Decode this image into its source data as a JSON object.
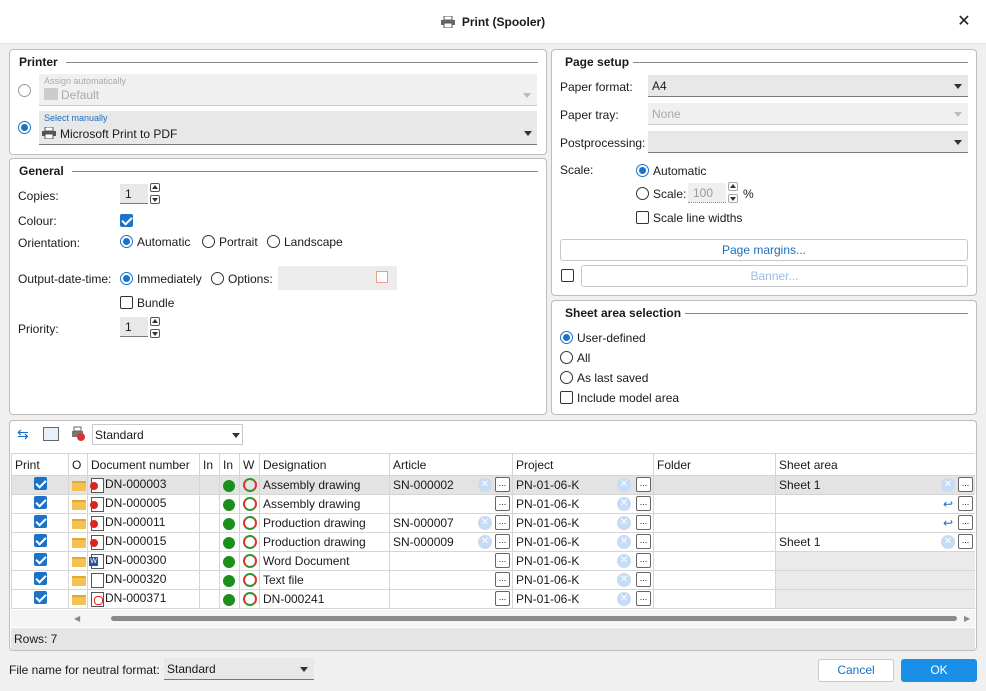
{
  "dialog": {
    "title": "Print (Spooler)"
  },
  "printer": {
    "section_title": "Printer",
    "auto_label": "Assign automatically",
    "auto_value": "Default",
    "manual_label": "Select manually",
    "manual_value": "Microsoft Print to PDF"
  },
  "general": {
    "section_title": "General",
    "copies_label": "Copies:",
    "copies_value": "1",
    "colour_label": "Colour:",
    "orientation_label": "Orientation:",
    "orient_automatic": "Automatic",
    "orient_portrait": "Portrait",
    "orient_landscape": "Landscape",
    "output_label": "Output-date-time:",
    "output_immediately": "Immediately",
    "output_options": "Options:",
    "bundle_label": "Bundle",
    "priority_label": "Priority:",
    "priority_value": "1"
  },
  "page_setup": {
    "section_title": "Page setup",
    "paper_format_label": "Paper format:",
    "paper_format_value": "A4",
    "paper_tray_label": "Paper tray:",
    "paper_tray_value": "None",
    "postprocessing_label": "Postprocessing:",
    "postprocessing_value": "",
    "scale_label": "Scale:",
    "scale_automatic": "Automatic",
    "scale_custom": "Scale:",
    "scale_value": "100",
    "scale_unit": "%",
    "scale_line_widths": "Scale line widths",
    "page_margins_button": "Page margins...",
    "banner_button": "Banner..."
  },
  "sheet_area": {
    "section_title": "Sheet area selection",
    "user_defined": "User-defined",
    "all": "All",
    "as_last_saved": "As last saved",
    "include_model_area": "Include model area"
  },
  "toolbar": {
    "profile_value": "Standard"
  },
  "table": {
    "headers": [
      "Print",
      "O",
      "Document number",
      "In",
      "In",
      "W",
      "Designation",
      "Article",
      "Project",
      "Folder",
      "Sheet area"
    ],
    "rows": [
      {
        "doc": "DN-000003",
        "designation": "Assembly drawing",
        "article": "SN-000002",
        "project": "PN-01-06-K",
        "sheet": "Sheet 1",
        "icon": "red"
      },
      {
        "doc": "DN-000005",
        "designation": "Assembly drawing",
        "article": "",
        "project": "PN-01-06-K",
        "sheet": "",
        "icon": "red"
      },
      {
        "doc": "DN-000011",
        "designation": "Production drawing",
        "article": "SN-000007",
        "project": "PN-01-06-K",
        "sheet": "",
        "icon": "red"
      },
      {
        "doc": "DN-000015",
        "designation": "Production drawing",
        "article": "SN-000009",
        "project": "PN-01-06-K",
        "sheet": "Sheet 1",
        "icon": "red"
      },
      {
        "doc": "DN-000300",
        "designation": "Word Document",
        "article": "",
        "project": "PN-01-06-K",
        "sheet": "",
        "icon": "word"
      },
      {
        "doc": "DN-000320",
        "designation": "Text file",
        "article": "",
        "project": "PN-01-06-K",
        "sheet": "",
        "icon": "text"
      },
      {
        "doc": "DN-000371",
        "designation": "DN-000241",
        "article": "",
        "project": "PN-01-06-K",
        "sheet": "",
        "icon": "pdf"
      }
    ],
    "rows_count": "Rows: 7"
  },
  "footer": {
    "neutral_label": "File name for neutral format:",
    "neutral_value": "Standard",
    "cancel": "Cancel",
    "ok": "OK"
  },
  "colors": {
    "accent": "#1a73c8",
    "ok_button": "#1a8fe8"
  }
}
